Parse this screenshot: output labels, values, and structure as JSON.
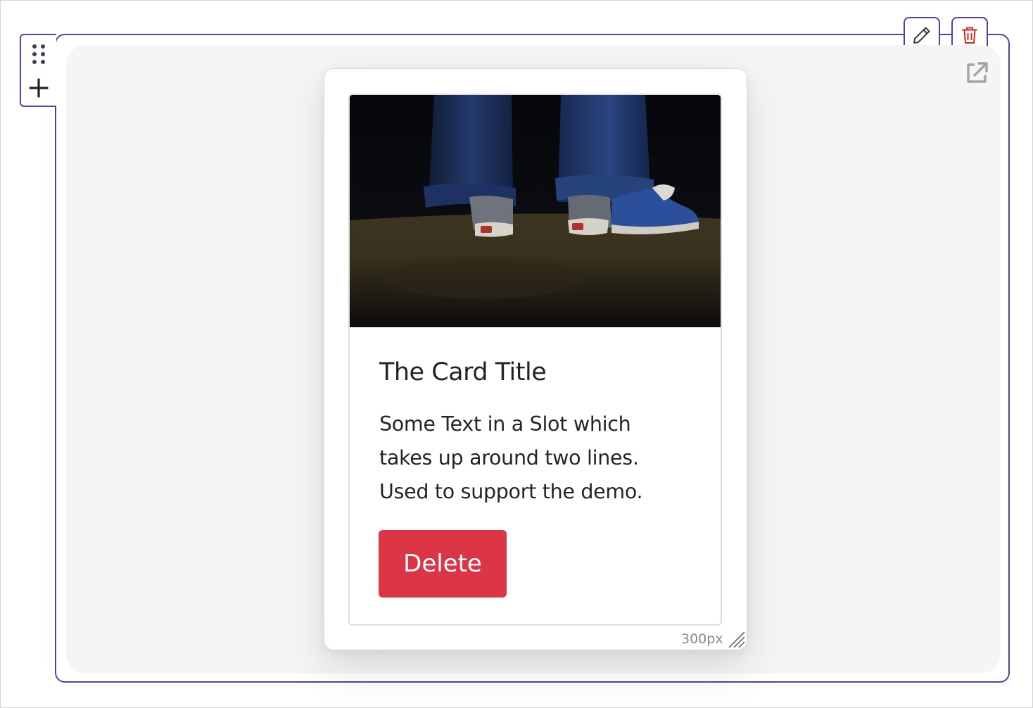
{
  "toolbar": {
    "drag_icon": "drag-handle-icon",
    "add_icon": "plus-icon",
    "edit_icon": "pencil-icon",
    "delete_icon": "trash-icon",
    "open_icon": "external-link-icon"
  },
  "card": {
    "image_alt": "sneakers",
    "title": "The Card Title",
    "text": "Some Text in a Slot which takes up around two lines. Used to support the demo.",
    "button_label": "Delete"
  },
  "preview": {
    "width_label": "300px"
  },
  "colors": {
    "accent": "#5b3fa8",
    "danger": "#dc3545",
    "delete_icon": "#cc2a22"
  }
}
